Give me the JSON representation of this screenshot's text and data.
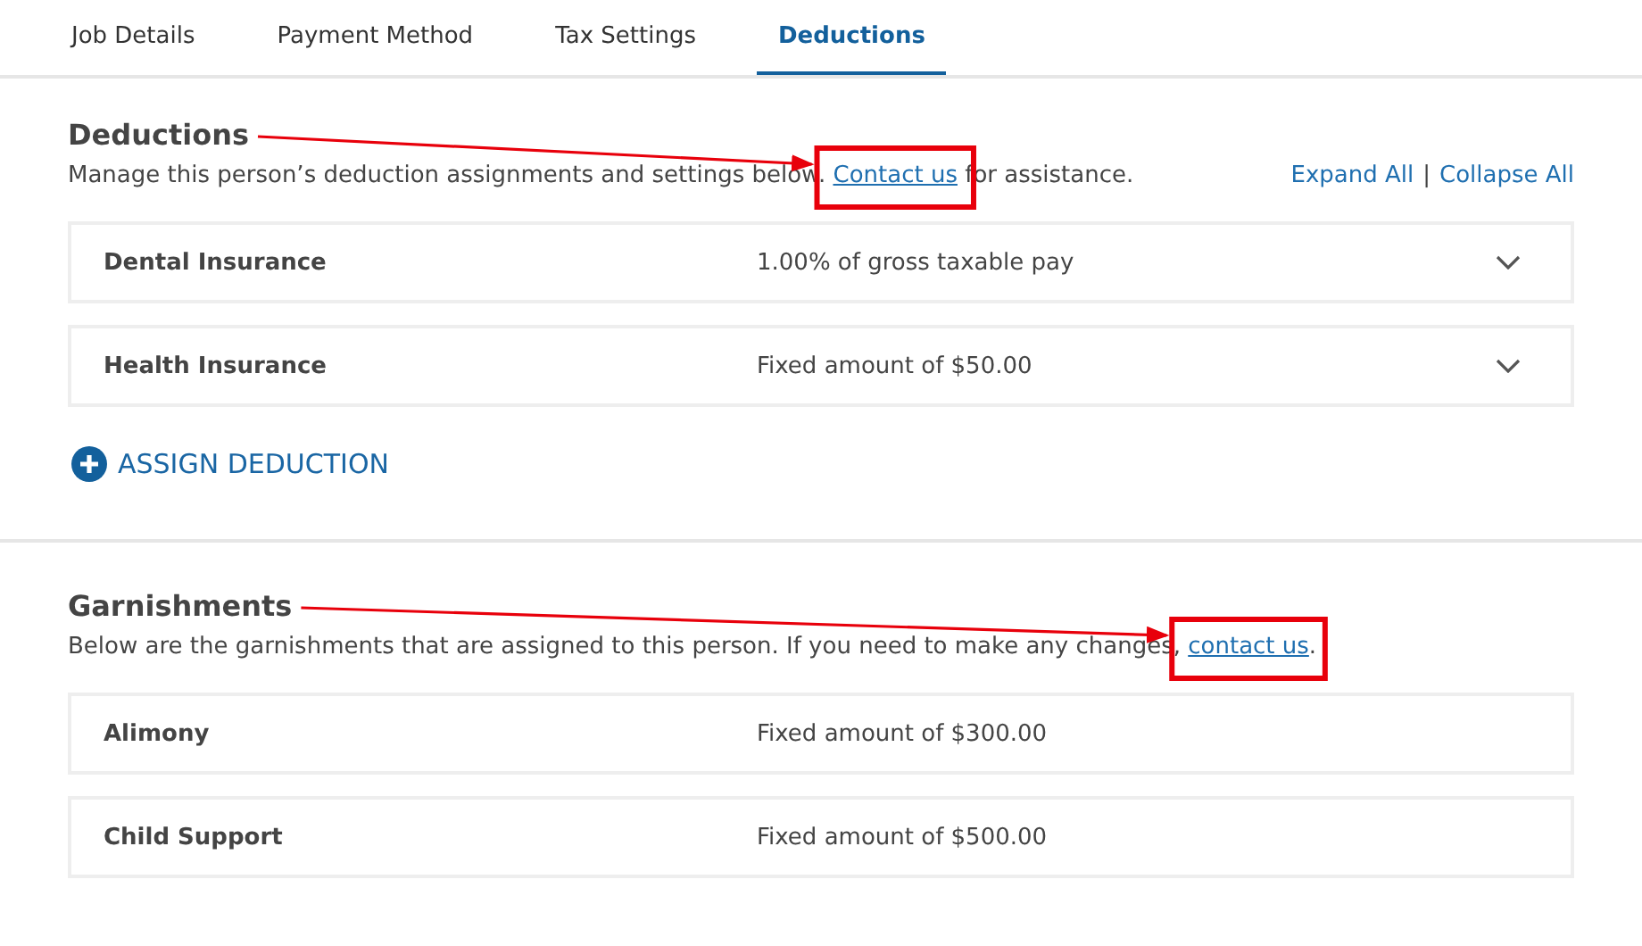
{
  "tabs": [
    {
      "label": "Job Details",
      "selected": false
    },
    {
      "label": "Payment Method",
      "selected": false
    },
    {
      "label": "Tax Settings",
      "selected": false
    },
    {
      "label": "Deductions",
      "selected": true
    }
  ],
  "deductions": {
    "title": "Deductions",
    "description": {
      "before": "Manage this person’s deduction assignments and settings below. ",
      "link": "Contact us",
      "after": " for assistance."
    },
    "expand_all": "Expand All",
    "separator": "|",
    "collapse_all": "Collapse All",
    "items": [
      {
        "name": "Dental Insurance",
        "amount": "1.00% of gross taxable pay",
        "expanded": false
      },
      {
        "name": "Health Insurance",
        "amount": "Fixed amount of $50.00",
        "expanded": false
      }
    ],
    "assign_button": "ASSIGN DEDUCTION"
  },
  "garnishments": {
    "title": "Garnishments",
    "description": {
      "before": "Below are the garnishments that are assigned to this person. If you need to make any changes, ",
      "link": "contact us",
      "after": "."
    },
    "items": [
      {
        "name": "Alimony",
        "amount": "Fixed amount of $300.00"
      },
      {
        "name": "Child Support",
        "amount": "Fixed amount of $500.00"
      }
    ]
  }
}
